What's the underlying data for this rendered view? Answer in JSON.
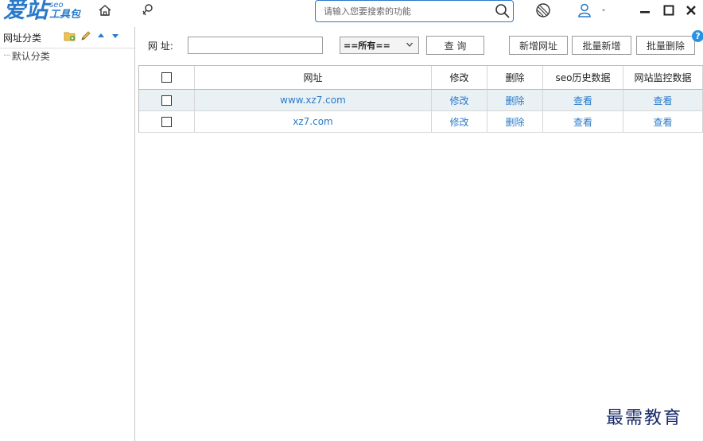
{
  "app": {
    "logo_main": "爱站",
    "logo_seo": "seo",
    "logo_tool": "工具包"
  },
  "search": {
    "placeholder": "请输入您要搜索的功能"
  },
  "sidebar": {
    "title": "网址分类",
    "items": [
      {
        "label": "默认分类"
      }
    ]
  },
  "toolbar": {
    "url_label": "网 址:",
    "url_value": "",
    "filter_value": "==所有==",
    "query_label": "查 询",
    "add_label": "新增网址",
    "batch_add_label": "批量新增",
    "batch_delete_label": "批量删除"
  },
  "table": {
    "columns": [
      "",
      "网址",
      "修改",
      "删除",
      "seo历史数据",
      "网站监控数据"
    ],
    "rows": [
      {
        "url": "www.xz7.com",
        "edit": "修改",
        "delete": "删除",
        "seo": "查看",
        "monitor": "查看"
      },
      {
        "url": "xz7.com",
        "edit": "修改",
        "delete": "删除",
        "seo": "查看",
        "monitor": "查看"
      }
    ]
  },
  "watermark": "最需教育",
  "colors": {
    "accent": "#2a7ac9",
    "row_alt": "#eaf1f5"
  }
}
